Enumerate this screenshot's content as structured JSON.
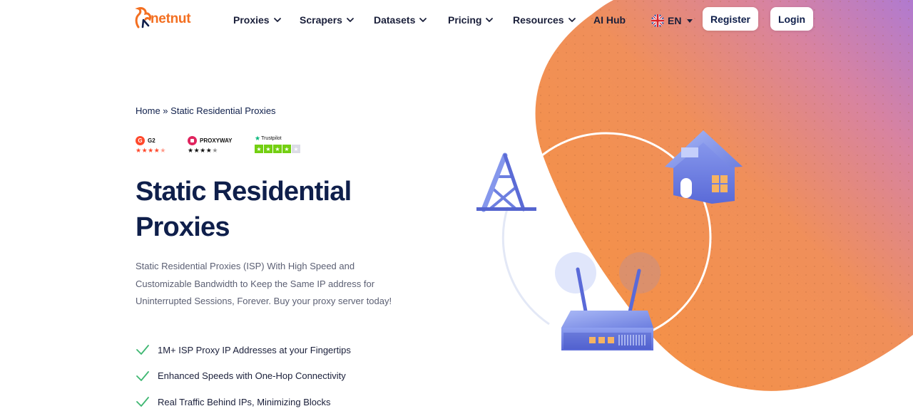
{
  "brand": {
    "name": "netnut"
  },
  "nav": {
    "items": [
      {
        "label": "Proxies",
        "has_dropdown": true
      },
      {
        "label": "Scrapers",
        "has_dropdown": true
      },
      {
        "label": "Datasets",
        "has_dropdown": true
      },
      {
        "label": "Pricing",
        "has_dropdown": true
      },
      {
        "label": "Resources",
        "has_dropdown": true
      },
      {
        "label": "AI Hub",
        "has_dropdown": false
      }
    ],
    "language": "EN",
    "register_label": "Register",
    "login_label": "Login"
  },
  "breadcrumb": {
    "home": "Home",
    "separator": " » ",
    "current": "Static Residential Proxies"
  },
  "ratings": {
    "g2": {
      "label": "G2",
      "stars": 4.5
    },
    "proxyway": {
      "label": "PROXYWAY",
      "stars": 4.5
    },
    "trustpilot": {
      "label": "Trustpilot",
      "stars": 4
    }
  },
  "hero": {
    "title_line1": "Static Residential",
    "title_line2": "Proxies",
    "description": "Static Residential Proxies (ISP) With High Speed and Customizable Bandwidth to Keep the Same IP address for Uninterrupted Sessions, Forever. Buy your proxy server today!"
  },
  "features": [
    "1M+ ISP Proxy IP Addresses at your Fingertips",
    "Enhanced Speeds with One-Hop Connectivity",
    "Real Traffic Behind IPs, Minimizing Blocks"
  ],
  "colors": {
    "brand_orange": "#f36f21",
    "navy": "#0f1f4b",
    "blob_orange": "#f4944a",
    "blob_purple": "#b478c8",
    "check_green": "#3fb772",
    "illustration_blue": "#6d7fe0"
  },
  "icons": {
    "logo": "squirrel-logo-icon",
    "chevron": "chevron-down-icon",
    "flag": "uk-flag-icon",
    "check": "check-icon",
    "tower": "cell-tower-icon",
    "house": "house-icon",
    "router": "router-icon"
  }
}
